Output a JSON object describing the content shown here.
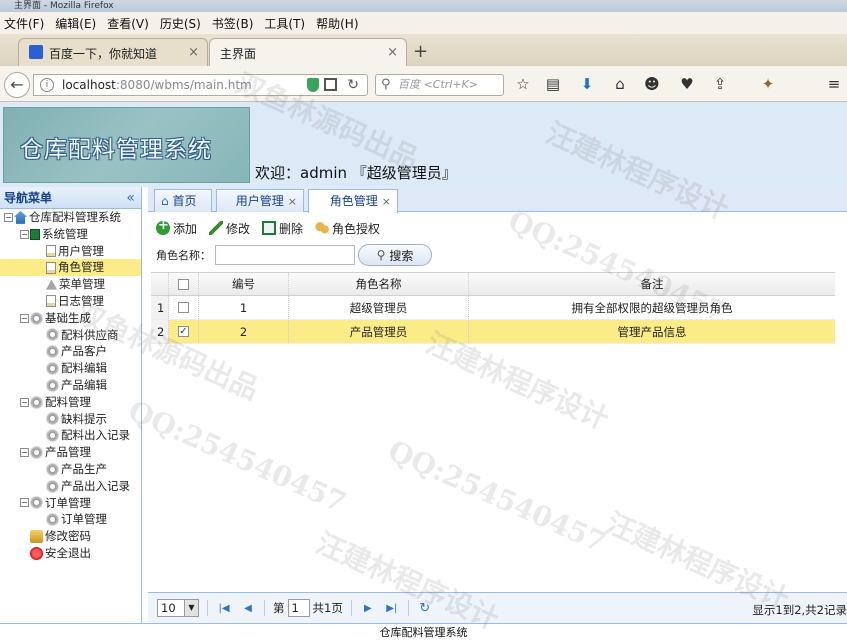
{
  "browser": {
    "window_title": "主界面 - Mozilla Firefox",
    "menu": [
      "文件(F)",
      "编辑(E)",
      "查看(V)",
      "历史(S)",
      "书签(B)",
      "工具(T)",
      "帮助(H)"
    ],
    "tabs": [
      {
        "label": "百度一下，你就知道"
      },
      {
        "label": "主界面"
      }
    ],
    "url_host": "localhost",
    "url_rest": ":8080/wbms/main.htm",
    "search_placeholder": "百度 <Ctrl+K>"
  },
  "app": {
    "title": "仓库配料管理系统",
    "welcome": "欢迎：admin 『超级管理员』"
  },
  "sidebar": {
    "title": "导航菜单",
    "collapse": "«",
    "tree": [
      {
        "label": "仓库配料管理系统",
        "level": 0,
        "toggle": "−",
        "icon": "home"
      },
      {
        "label": "系统管理",
        "level": 1,
        "toggle": "−",
        "icon": "menu"
      },
      {
        "label": "用户管理",
        "level": 2,
        "icon": "doc"
      },
      {
        "label": "角色管理",
        "level": 2,
        "icon": "doc",
        "selected": true
      },
      {
        "label": "菜单管理",
        "level": 2,
        "icon": "tree"
      },
      {
        "label": "日志管理",
        "level": 2,
        "icon": "doc"
      },
      {
        "label": "基础生成",
        "level": 1,
        "toggle": "−",
        "icon": "gear"
      },
      {
        "label": "配料供应商",
        "level": 2,
        "icon": "gear"
      },
      {
        "label": "产品客户",
        "level": 2,
        "icon": "gear"
      },
      {
        "label": "配料编辑",
        "level": 2,
        "icon": "gear"
      },
      {
        "label": "产品编辑",
        "level": 2,
        "icon": "gear"
      },
      {
        "label": "配料管理",
        "level": 1,
        "toggle": "−",
        "icon": "gear"
      },
      {
        "label": "缺料提示",
        "level": 2,
        "icon": "gear"
      },
      {
        "label": "配料出入记录",
        "level": 2,
        "icon": "gear"
      },
      {
        "label": "产品管理",
        "level": 1,
        "toggle": "−",
        "icon": "gear"
      },
      {
        "label": "产品生产",
        "level": 2,
        "icon": "gear"
      },
      {
        "label": "产品出入记录",
        "level": 2,
        "icon": "gear"
      },
      {
        "label": "订单管理",
        "level": 1,
        "toggle": "−",
        "icon": "gear"
      },
      {
        "label": "订单管理",
        "level": 2,
        "icon": "gear"
      },
      {
        "label": "修改密码",
        "level": 1,
        "icon": "key"
      },
      {
        "label": "安全退出",
        "level": 1,
        "icon": "exit"
      }
    ]
  },
  "main": {
    "tabs": [
      {
        "label": "首页",
        "closable": false
      },
      {
        "label": "用户管理",
        "closable": true
      },
      {
        "label": "角色管理",
        "closable": true,
        "active": true
      }
    ],
    "close_glyph": "×",
    "toolbar": {
      "add": "添加",
      "edit": "修改",
      "delete": "删除",
      "grant": "角色授权"
    },
    "filter": {
      "label": "角色名称：",
      "value": "",
      "search": "搜索"
    },
    "grid": {
      "headers": {
        "id": "编号",
        "name": "角色名称",
        "note": "备注"
      },
      "rows": [
        {
          "no": "1",
          "checked": false,
          "id": "1",
          "name": "超级管理员",
          "note": "拥有全部权限的超级管理员角色"
        },
        {
          "no": "2",
          "checked": true,
          "id": "2",
          "name": "产品管理员",
          "note": "管理产品信息"
        }
      ]
    },
    "pager": {
      "page_size": "10",
      "page_prefix": "第",
      "page": "1",
      "page_suffix": "共1页",
      "info": "显示1到2,共2记录"
    }
  },
  "footer": "仓库配料管理系统",
  "watermarks": [
    "双鱼林源码出品",
    "汪建林程序设计",
    "QQ:254540457"
  ]
}
